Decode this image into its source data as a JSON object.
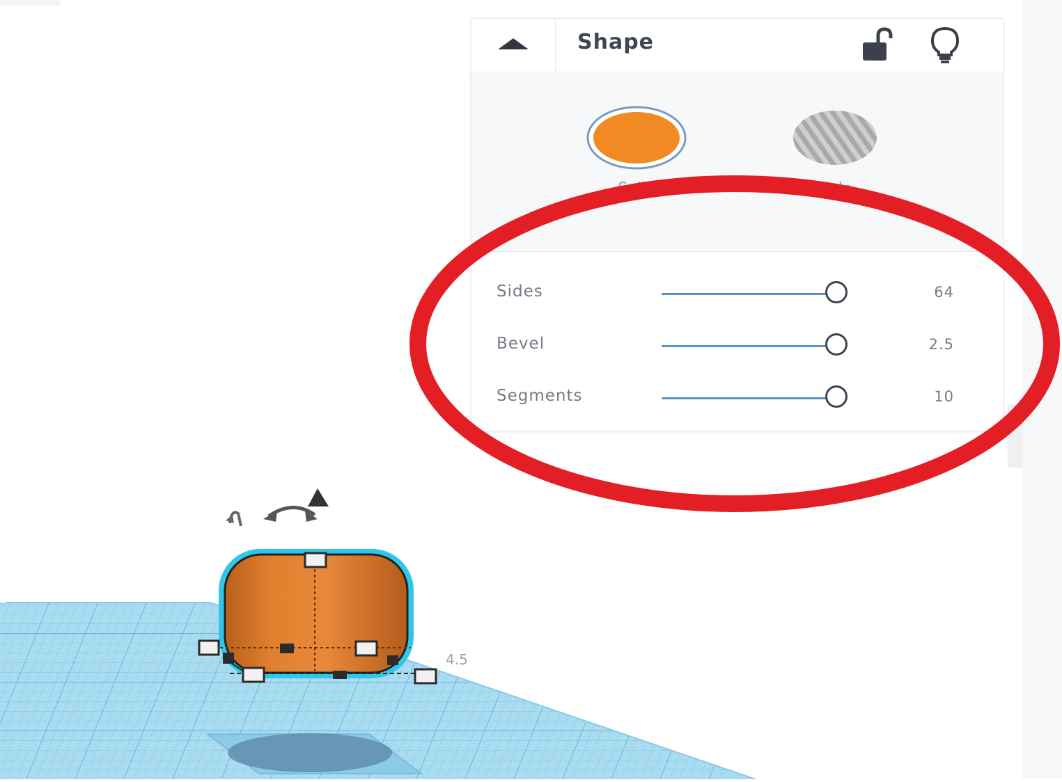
{
  "panel": {
    "title": "Shape",
    "icons": {
      "collapse": "caret-up-icon",
      "lock": "unlock-icon",
      "bulb": "lightbulb-icon"
    },
    "swatches": [
      {
        "name": "solid",
        "label": "Solid",
        "color": "#f28a24",
        "selected": true
      },
      {
        "name": "hole",
        "label": "Hole",
        "color": "#bdbdbd",
        "selected": false
      }
    ],
    "properties": [
      {
        "label": "Sides",
        "value": "64"
      },
      {
        "label": "Bevel",
        "value": "2.5"
      },
      {
        "label": "Segments",
        "value": "10"
      }
    ]
  },
  "colors": {
    "accent": "#f28a24",
    "workplane": "#a9dcf0",
    "selection_outline": "#2fc6e8",
    "slider": "#5b8fc7",
    "annotation": "#e31e24"
  },
  "workplane": {
    "icons": [
      "rotate-arrow-icon",
      "rotate-arrow-icon",
      "lift-cone-icon"
    ],
    "measurement_fragment": "4.5"
  }
}
